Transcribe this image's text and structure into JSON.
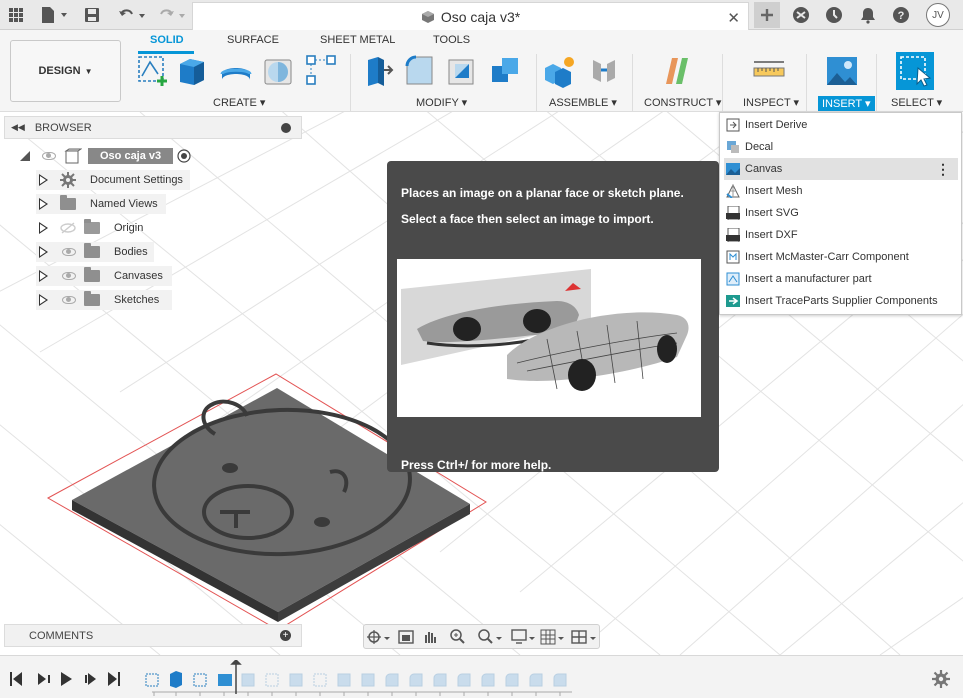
{
  "window": {
    "doc_title": "Oso caja v3*",
    "user_initials": "JV"
  },
  "ribbon": {
    "workspace": "DESIGN",
    "tabs": [
      "SOLID",
      "SURFACE",
      "SHEET METAL",
      "TOOLS"
    ],
    "groups": {
      "create": "CREATE",
      "modify": "MODIFY",
      "assemble": "ASSEMBLE",
      "construct": "CONSTRUCT",
      "inspect": "INSPECT",
      "insert": "INSERT",
      "select": "SELECT"
    }
  },
  "browser": {
    "title": "BROWSER",
    "root": "Oso caja v3",
    "items": [
      {
        "label": "Document Settings",
        "icon": "gear-icon"
      },
      {
        "label": "Named Views",
        "icon": "folder-icon"
      },
      {
        "label": "Origin",
        "icon": "folder-icon"
      },
      {
        "label": "Bodies",
        "icon": "folder-icon"
      },
      {
        "label": "Canvases",
        "icon": "folder-icon"
      },
      {
        "label": "Sketches",
        "icon": "folder-icon"
      }
    ]
  },
  "tooltip": {
    "line1": "Places an image on a planar face or sketch plane.",
    "line2": "Select a face then select an image to import.",
    "help": "Press Ctrl+/ for more help."
  },
  "insert_menu": {
    "items": [
      {
        "label": "Insert Derive",
        "icon": "derive-icon"
      },
      {
        "label": "Decal",
        "icon": "decal-icon"
      },
      {
        "label": "Canvas",
        "icon": "canvas-icon"
      },
      {
        "label": "Insert Mesh",
        "icon": "mesh-icon"
      },
      {
        "label": "Insert SVG",
        "icon": "svg-icon"
      },
      {
        "label": "Insert DXF",
        "icon": "dxf-icon"
      },
      {
        "label": "Insert McMaster-Carr Component",
        "icon": "mcmaster-icon"
      },
      {
        "label": "Insert a manufacturer part",
        "icon": "manufacturer-icon"
      },
      {
        "label": "Insert TraceParts Supplier Components",
        "icon": "traceparts-icon"
      }
    ],
    "highlighted": "Canvas"
  },
  "comments": {
    "title": "COMMENTS"
  },
  "colors": {
    "accent": "#0696d7",
    "tooltip_bg": "#4a4a4a",
    "plate": "#666666"
  }
}
